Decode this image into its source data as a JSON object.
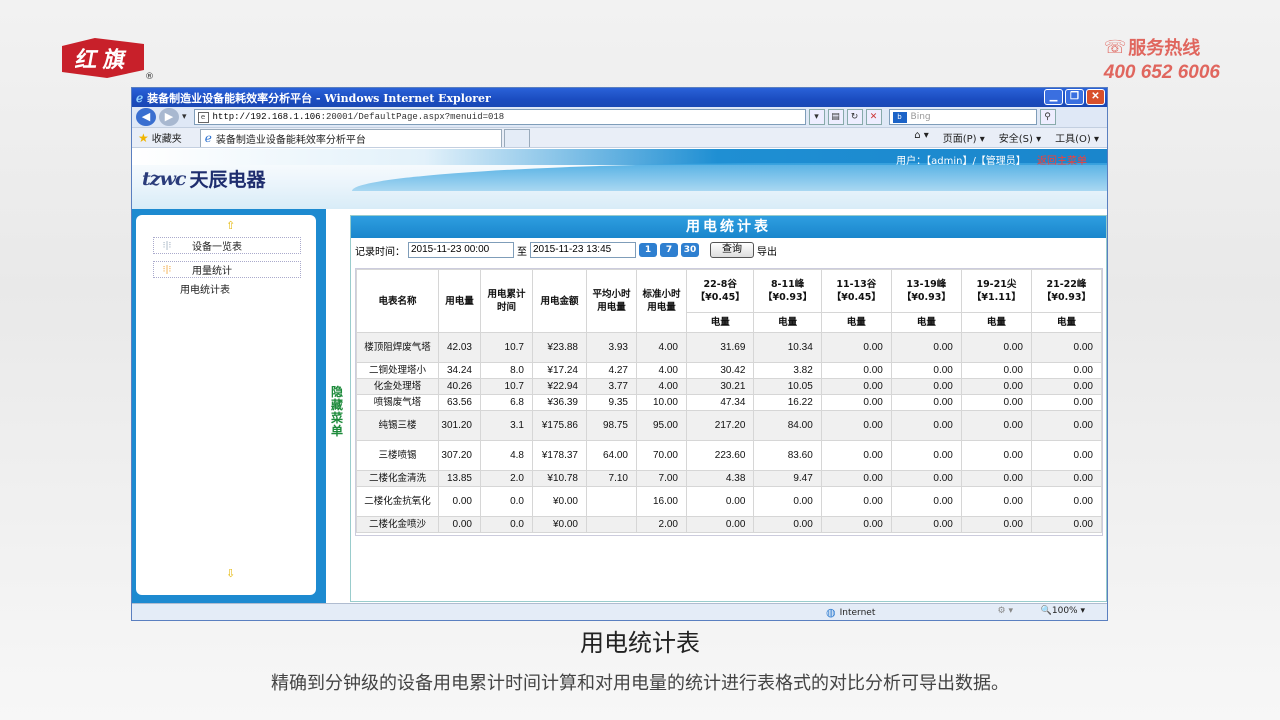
{
  "slide": {
    "logo_text": "红旗",
    "logo_reg": "®",
    "hotline_title": "服务热线",
    "hotline_number": "400 652 6006",
    "caption_title": "用电统计表",
    "caption_desc": "精确到分钟级的设备用电累计时间计算和对用电量的统计进行表格式的对比分析可导出数据。"
  },
  "browser": {
    "window_title": "装备制造业设备能耗效率分析平台 - Windows Internet Explorer",
    "url_host": "http://192.168.1.106",
    "url_rest": ":20001/DefaultPage.aspx?menuid=018",
    "search_placeholder": "Bing",
    "favorites_label": "收藏夹",
    "tab_title": "装备制造业设备能耗效率分析平台",
    "cmd_page": "页面(P) ▾",
    "cmd_safety": "安全(S) ▾",
    "cmd_tools": "工具(O) ▾",
    "status_zone": "Internet",
    "status_zoom": "🔍100% ▾"
  },
  "app": {
    "brand_mark": "tzwc",
    "brand_name": "天辰电器",
    "user_label": "用户：【admin】/【管理员】",
    "back_link": "返回主菜单",
    "hide_menu": "隐藏菜单",
    "menu": [
      {
        "label": "设备一览表"
      },
      {
        "label": "用量统计"
      }
    ],
    "submenu": [
      {
        "label": "用电统计表"
      }
    ]
  },
  "report": {
    "title": "用电统计表",
    "record_time_label": "记录时间：",
    "start_time": "2015-11-23 00:00",
    "to_label": "至",
    "end_time": "2015-11-23 13:45",
    "btn_day": "1",
    "btn_week": "7",
    "btn_month": "30",
    "query_label": "查询",
    "export_label": "导出",
    "headers": {
      "name": "电表名称",
      "usage": "用电量",
      "cum_time": "用电累计时间",
      "amount": "用电金额",
      "avg_hour": "平均小时用电量",
      "std_hour": "标准小时用电量",
      "periods": [
        {
          "label": "22-8谷【¥0.45】",
          "sub": "电量"
        },
        {
          "label": "8-11峰【¥0.93】",
          "sub": "电量"
        },
        {
          "label": "11-13谷【¥0.45】",
          "sub": "电量"
        },
        {
          "label": "13-19峰【¥0.93】",
          "sub": "电量"
        },
        {
          "label": "19-21尖【¥1.11】",
          "sub": "电量"
        },
        {
          "label": "21-22峰【¥0.93】",
          "sub": "电量"
        }
      ]
    },
    "rows": [
      {
        "name": "楼顶阻焊废气塔",
        "usage": "42.03",
        "time": "10.7",
        "amount": "¥23.88",
        "avg": "3.93",
        "std": "4.00",
        "p": [
          "31.69",
          "10.34",
          "0.00",
          "0.00",
          "0.00",
          "0.00"
        ]
      },
      {
        "name": "二铜处理塔小",
        "usage": "34.24",
        "time": "8.0",
        "amount": "¥17.24",
        "avg": "4.27",
        "std": "4.00",
        "p": [
          "30.42",
          "3.82",
          "0.00",
          "0.00",
          "0.00",
          "0.00"
        ]
      },
      {
        "name": "化金处理塔",
        "usage": "40.26",
        "time": "10.7",
        "amount": "¥22.94",
        "avg": "3.77",
        "std": "4.00",
        "p": [
          "30.21",
          "10.05",
          "0.00",
          "0.00",
          "0.00",
          "0.00"
        ]
      },
      {
        "name": "喷锡废气塔",
        "usage": "63.56",
        "time": "6.8",
        "amount": "¥36.39",
        "avg": "9.35",
        "std": "10.00",
        "p": [
          "47.34",
          "16.22",
          "0.00",
          "0.00",
          "0.00",
          "0.00"
        ]
      },
      {
        "name": "纯锡三楼",
        "usage": "301.20",
        "time": "3.1",
        "amount": "¥175.86",
        "avg": "98.75",
        "std": "95.00",
        "p": [
          "217.20",
          "84.00",
          "0.00",
          "0.00",
          "0.00",
          "0.00"
        ]
      },
      {
        "name": "三楼喷锡",
        "usage": "307.20",
        "time": "4.8",
        "amount": "¥178.37",
        "avg": "64.00",
        "std": "70.00",
        "p": [
          "223.60",
          "83.60",
          "0.00",
          "0.00",
          "0.00",
          "0.00"
        ]
      },
      {
        "name": "二楼化金清洗",
        "usage": "13.85",
        "time": "2.0",
        "amount": "¥10.78",
        "avg": "7.10",
        "std": "7.00",
        "p": [
          "4.38",
          "9.47",
          "0.00",
          "0.00",
          "0.00",
          "0.00"
        ]
      },
      {
        "name": "二楼化金抗氧化",
        "usage": "0.00",
        "time": "0.0",
        "amount": "¥0.00",
        "avg": "",
        "std": "16.00",
        "p": [
          "0.00",
          "0.00",
          "0.00",
          "0.00",
          "0.00",
          "0.00"
        ]
      },
      {
        "name": "二楼化金喷沙",
        "usage": "0.00",
        "time": "0.0",
        "amount": "¥0.00",
        "avg": "",
        "std": "2.00",
        "p": [
          "0.00",
          "0.00",
          "0.00",
          "0.00",
          "0.00",
          "0.00"
        ]
      }
    ]
  }
}
